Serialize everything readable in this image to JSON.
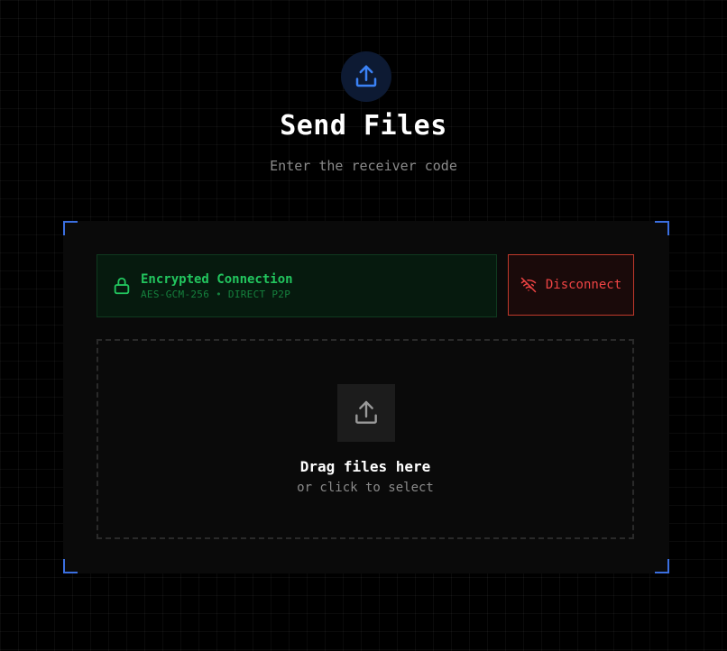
{
  "header": {
    "icon": "upload-icon",
    "title": "Send Files",
    "subtitle": "Enter the receiver code"
  },
  "connection": {
    "icon": "lock-icon",
    "title": "Encrypted Connection",
    "subtitle": "AES-GCM-256 • DIRECT P2P",
    "status_color": "#22c55e"
  },
  "disconnect": {
    "icon": "wifi-off-icon",
    "label": "Disconnect",
    "color": "#ef4444"
  },
  "dropzone": {
    "icon": "upload-icon",
    "title": "Drag files here",
    "subtitle": "or click to select"
  },
  "colors": {
    "accent": "#3b6fe0",
    "background": "#000000",
    "panel": "#0a0a0a"
  }
}
